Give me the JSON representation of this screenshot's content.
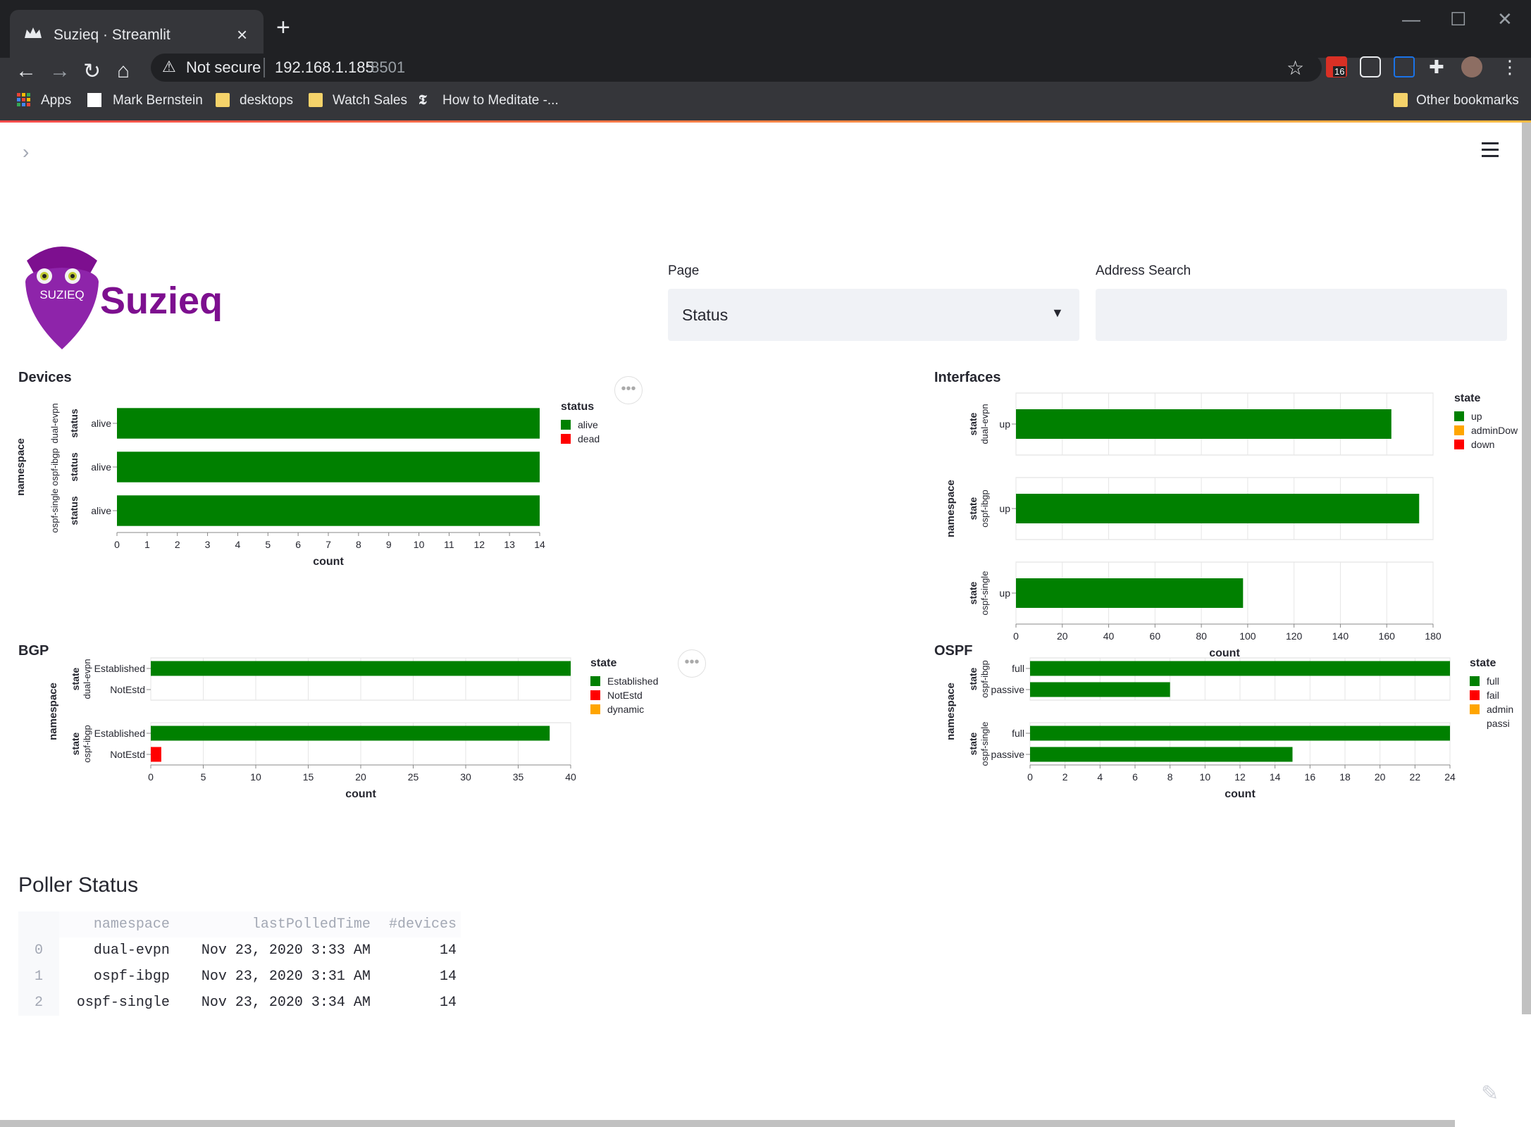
{
  "browser": {
    "tab_title": "Suzieq · Streamlit",
    "tab_close": "×",
    "new_tab": "+",
    "address": {
      "security": "Not secure",
      "host": "192.168.1.185",
      "port": ":8501"
    },
    "extension_badge": "16",
    "bookmarks": [
      "Apps",
      "Mark Bernstein",
      "desktops",
      "Watch Sales",
      "How to Meditate -..."
    ],
    "other_bookmarks": "Other bookmarks"
  },
  "header": {
    "brand": "Suzieq",
    "logo_text": "SUZIEQ"
  },
  "controls": {
    "page_label": "Page",
    "page_value": "Status",
    "address_label": "Address Search",
    "address_value": ""
  },
  "charts": [
    {
      "id": "devices",
      "title": "Devices",
      "facet_label": "namespace",
      "row_label": "status",
      "legend_title": "status",
      "legend": [
        {
          "label": "alive",
          "color": "#008000"
        },
        {
          "label": "dead",
          "color": "#ff0000"
        }
      ],
      "xlabel": "count",
      "ticks": [
        0,
        1,
        2,
        3,
        4,
        5,
        6,
        7,
        8,
        9,
        10,
        11,
        12,
        13,
        14
      ],
      "xmax": 14,
      "grid": false,
      "facets": [
        {
          "name": "dual-evpn",
          "rows": [
            {
              "label": "alive",
              "value": 14,
              "color": "#008000"
            }
          ]
        },
        {
          "name": "ospf-ibgp",
          "rows": [
            {
              "label": "alive",
              "value": 14,
              "color": "#008000"
            }
          ]
        },
        {
          "name": "ospf-single",
          "rows": [
            {
              "label": "alive",
              "value": 14,
              "color": "#008000"
            }
          ]
        }
      ]
    },
    {
      "id": "interfaces",
      "title": "Interfaces",
      "facet_label": "namespace",
      "row_label": "state",
      "legend_title": "state",
      "legend": [
        {
          "label": "up",
          "color": "#008000"
        },
        {
          "label": "adminDow",
          "color": "#ffa500"
        },
        {
          "label": "down",
          "color": "#ff0000"
        }
      ],
      "xlabel": "count",
      "ticks": [
        0,
        20,
        40,
        60,
        80,
        100,
        120,
        140,
        160,
        180
      ],
      "xmax": 180,
      "grid": true,
      "facets": [
        {
          "name": "dual-evpn",
          "rows": [
            {
              "label": "up",
              "value": 162,
              "color": "#008000"
            }
          ]
        },
        {
          "name": "ospf-ibgp",
          "rows": [
            {
              "label": "up",
              "value": 174,
              "color": "#008000"
            }
          ]
        },
        {
          "name": "ospf-single",
          "rows": [
            {
              "label": "up",
              "value": 98,
              "color": "#008000"
            }
          ]
        }
      ]
    },
    {
      "id": "bgp",
      "title": "BGP",
      "facet_label": "namespace",
      "row_label": "state",
      "legend_title": "state",
      "legend": [
        {
          "label": "Established",
          "color": "#008000"
        },
        {
          "label": "NotEstd",
          "color": "#ff0000"
        },
        {
          "label": "dynamic",
          "color": "#ffa500"
        }
      ],
      "xlabel": "count",
      "ticks": [
        0,
        5,
        10,
        15,
        20,
        25,
        30,
        35,
        40
      ],
      "xmax": 40,
      "grid": true,
      "facets": [
        {
          "name": "dual-evpn",
          "rows": [
            {
              "label": "Established",
              "value": 40,
              "color": "#008000"
            },
            {
              "label": "NotEstd",
              "value": 0,
              "color": "#ff0000"
            }
          ]
        },
        {
          "name": "ospf-ibgp",
          "rows": [
            {
              "label": "Established",
              "value": 38,
              "color": "#008000"
            },
            {
              "label": "NotEstd",
              "value": 1,
              "color": "#ff0000"
            }
          ]
        }
      ]
    },
    {
      "id": "ospf",
      "title": "OSPF",
      "facet_label": "namespace",
      "row_label": "state",
      "legend_title": "state",
      "legend": [
        {
          "label": "full",
          "color": "#008000"
        },
        {
          "label": "fail",
          "color": "#ff0000"
        },
        {
          "label": "admin",
          "color": "#ffa500"
        },
        {
          "label": "passi",
          "color": ""
        }
      ],
      "xlabel": "count",
      "ticks": [
        0,
        2,
        4,
        6,
        8,
        10,
        12,
        14,
        16,
        18,
        20,
        22,
        24
      ],
      "xmax": 24,
      "grid": true,
      "facets": [
        {
          "name": "ospf-ibgp",
          "rows": [
            {
              "label": "full",
              "value": 24,
              "color": "#008000"
            },
            {
              "label": "passive",
              "value": 8,
              "color": "#008000"
            }
          ]
        },
        {
          "name": "ospf-single",
          "rows": [
            {
              "label": "full",
              "value": 24,
              "color": "#008000"
            },
            {
              "label": "passive",
              "value": 15,
              "color": "#008000"
            }
          ]
        }
      ]
    }
  ],
  "poller": {
    "title": "Poller Status",
    "columns": [
      "",
      "namespace",
      "lastPolledTime",
      "#devices"
    ],
    "rows": [
      [
        "0",
        "dual-evpn",
        "Nov 23, 2020 3:33 AM",
        "14"
      ],
      [
        "1",
        "ospf-ibgp",
        "Nov 23, 2020 3:31 AM",
        "14"
      ],
      [
        "2",
        "ospf-single",
        "Nov 23, 2020 3:34 AM",
        "14"
      ]
    ]
  }
}
